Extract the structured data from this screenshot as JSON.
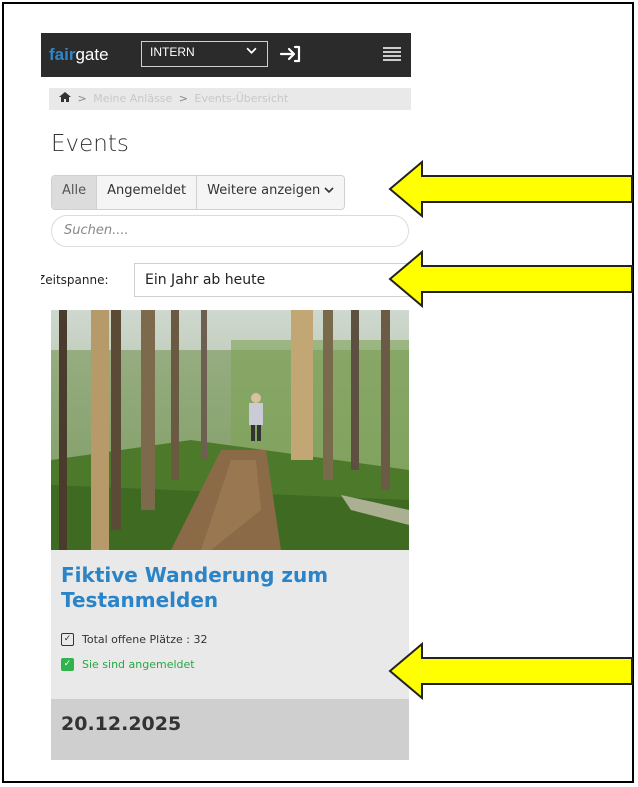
{
  "header": {
    "logo_accent": "fair",
    "logo_rest": "gate",
    "select_value": "INTERN",
    "icons": [
      "login-icon",
      "menu-icon"
    ]
  },
  "breadcrumb": {
    "items": [
      "Meine Anlässe",
      "Events-Übersicht"
    ]
  },
  "page": {
    "title": "Events"
  },
  "tabs": [
    {
      "label": "Alle",
      "active": true
    },
    {
      "label": "Angemeldet",
      "active": false
    },
    {
      "label": "Weitere anzeigen",
      "active": false
    }
  ],
  "search": {
    "placeholder": "Suchen...."
  },
  "timespan": {
    "label": "Zeitspanne:",
    "value": "Ein Jahr ab heute"
  },
  "event": {
    "title": "Fiktive Wanderung zum Testanmelden",
    "open_spots": "Total offene Plätze : 32",
    "registered": "Sie sind angemeldet",
    "date": "20.12.2025"
  },
  "colors": {
    "accent": "#2a84c7",
    "topbar": "#2b2b2b",
    "success": "#27a745",
    "annotation_arrow": "#ffff00"
  }
}
